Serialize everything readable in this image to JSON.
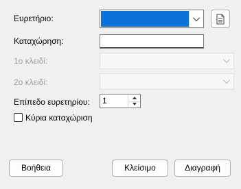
{
  "form": {
    "index_label": "Ευρετήριο:",
    "entry_label": "Καταχώρηση:",
    "entry_value": "",
    "key1_label": "1ο κλειδί:",
    "key2_label": "2ο κλειδί:",
    "level_label": "Επίπεδο ευρετηρίου:",
    "level_value": "1",
    "main_entry_label": "Κύρια καταχώριση",
    "main_entry_checked": false
  },
  "buttons": {
    "help": "Βοήθεια",
    "close": "Κλείσιμο",
    "delete": "Διαγραφή"
  },
  "colors": {
    "selection": "#0a72d6",
    "background": "#f0f0f0"
  },
  "icons": {
    "new_index": "document-icon"
  }
}
